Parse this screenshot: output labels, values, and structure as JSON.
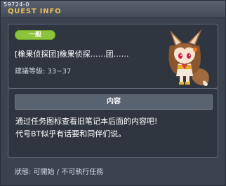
{
  "window": {
    "quest_id": "59724-0",
    "title": "QUEST INFO"
  },
  "quest": {
    "category": "一般",
    "name": "[橡果侦探团]橡果侦探……团……",
    "level": "建議等級: 33~37"
  },
  "content": {
    "header": "内容",
    "line1": "通过任务图标查看旧笔记本后面的内容吧!",
    "line2": "代号BT似乎有话要和同伴们说。"
  },
  "status": {
    "text": "狀態: 可開始 / 不可執行任務"
  },
  "colors": {
    "accent_title": "#e9c15a",
    "badge_green": "#8dc43d"
  },
  "icons": [
    "npc-portrait-fox-girl"
  ]
}
